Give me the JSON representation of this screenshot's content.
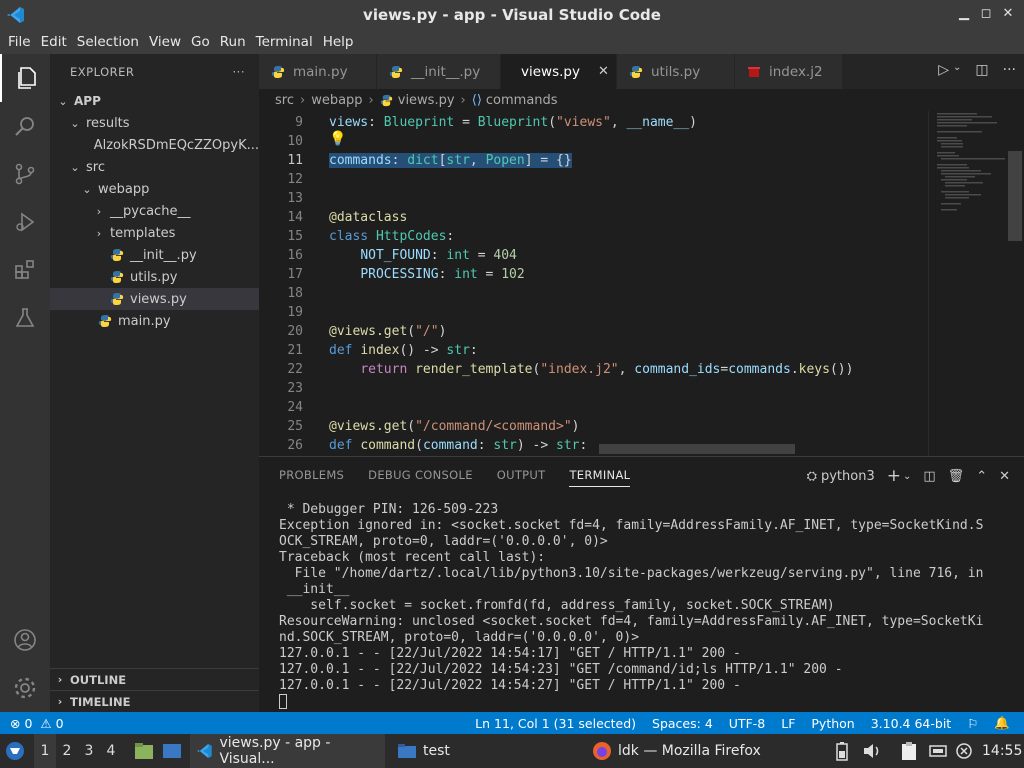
{
  "window": {
    "title": "views.py - app - Visual Studio Code"
  },
  "menu": [
    "File",
    "Edit",
    "Selection",
    "View",
    "Go",
    "Run",
    "Terminal",
    "Help"
  ],
  "sidebar": {
    "header": "EXPLORER",
    "more": "···",
    "tree": [
      {
        "label": "APP",
        "depth": 0,
        "chev": "⌄",
        "kind": "root"
      },
      {
        "label": "results",
        "depth": 1,
        "chev": "⌄",
        "kind": "folder"
      },
      {
        "label": "AlzokRSDmEQcZZOpyK...",
        "depth": 2,
        "chev": "",
        "kind": "file"
      },
      {
        "label": "src",
        "depth": 1,
        "chev": "⌄",
        "kind": "folder"
      },
      {
        "label": "webapp",
        "depth": 2,
        "chev": "⌄",
        "kind": "folder"
      },
      {
        "label": "__pycache__",
        "depth": 3,
        "chev": "›",
        "kind": "folder"
      },
      {
        "label": "templates",
        "depth": 3,
        "chev": "›",
        "kind": "folder"
      },
      {
        "label": "__init__.py",
        "depth": 3,
        "chev": "",
        "kind": "py"
      },
      {
        "label": "utils.py",
        "depth": 3,
        "chev": "",
        "kind": "py"
      },
      {
        "label": "views.py",
        "depth": 3,
        "chev": "",
        "kind": "py",
        "selected": true
      },
      {
        "label": "main.py",
        "depth": 2,
        "chev": "",
        "kind": "py"
      }
    ],
    "outline": "OUTLINE",
    "timeline": "TIMELINE"
  },
  "tabs": [
    {
      "label": "main.py",
      "icon": "python-icon",
      "active": false
    },
    {
      "label": "__init__.py",
      "icon": "python-icon",
      "active": false
    },
    {
      "label": "views.py",
      "icon": "python-icon",
      "active": true
    },
    {
      "label": "utils.py",
      "icon": "python-icon",
      "active": false
    },
    {
      "label": "index.j2",
      "icon": "jinja-icon",
      "active": false
    }
  ],
  "breadcrumb": [
    "src",
    "webapp",
    "views.py",
    "commands"
  ],
  "editor": {
    "lines": [
      {
        "n": "9",
        "html": "<span class='var'>views</span>: <span class='cls'>Blueprint</span> = <span class='cls'>Blueprint</span>(<span class='str'>\"views\"</span>, <span class='var'>__name__</span>)"
      },
      {
        "n": "10",
        "html": ""
      },
      {
        "n": "11",
        "html": "<span class='sel'><span class='var'>commands</span>: <span class='cls'>dict</span>[<span class='cls'>str</span>, <span class='cls'>Popen</span>] = {}</span>",
        "current": true
      },
      {
        "n": "12",
        "html": ""
      },
      {
        "n": "13",
        "html": ""
      },
      {
        "n": "14",
        "html": "<span class='dec'>@dataclass</span>"
      },
      {
        "n": "15",
        "html": "<span class='kw'>class</span> <span class='cls'>HttpCodes</span>:"
      },
      {
        "n": "16",
        "html": "    <span class='var'>NOT_FOUND</span>: <span class='cls'>int</span> = <span class='num'>404</span>"
      },
      {
        "n": "17",
        "html": "    <span class='var'>PROCESSING</span>: <span class='cls'>int</span> = <span class='num'>102</span>"
      },
      {
        "n": "18",
        "html": ""
      },
      {
        "n": "19",
        "html": ""
      },
      {
        "n": "20",
        "html": "<span class='dec'>@views.get</span>(<span class='str'>\"/\"</span>)"
      },
      {
        "n": "21",
        "html": "<span class='kw'>def</span> <span class='fn'>index</span>() -> <span class='cls'>str</span>:"
      },
      {
        "n": "22",
        "html": "    <span style='color:#c586c0'>return</span> <span class='fn'>render_template</span>(<span class='str'>\"index.j2\"</span>, <span class='var'>command_ids</span>=<span class='var'>commands</span>.<span class='fn'>keys</span>())"
      },
      {
        "n": "23",
        "html": ""
      },
      {
        "n": "24",
        "html": ""
      },
      {
        "n": "25",
        "html": "<span class='dec'>@views.get</span>(<span class='str'>\"/command/&lt;command&gt;\"</span>)"
      },
      {
        "n": "26",
        "html": "<span class='kw'>def</span> <span class='fn'>command</span>(<span class='var'>command</span>: <span class='cls'>str</span>) -> <span class='cls'>str</span>:"
      }
    ]
  },
  "panel": {
    "tabs": [
      "PROBLEMS",
      "DEBUG CONSOLE",
      "OUTPUT",
      "TERMINAL"
    ],
    "active_tab": "TERMINAL",
    "terminal_name": "python3",
    "terminal_lines": [
      " * Debugger PIN: 126-509-223",
      "Exception ignored in: <socket.socket fd=4, family=AddressFamily.AF_INET, type=SocketKind.S",
      "OCK_STREAM, proto=0, laddr=('0.0.0.0', 0)>",
      "Traceback (most recent call last):",
      "  File \"/home/dartz/.local/lib/python3.10/site-packages/werkzeug/serving.py\", line 716, in",
      " __init__",
      "    self.socket = socket.fromfd(fd, address_family, socket.SOCK_STREAM)",
      "ResourceWarning: unclosed <socket.socket fd=4, family=AddressFamily.AF_INET, type=SocketKi",
      "nd.SOCK_STREAM, proto=0, laddr=('0.0.0.0', 0)>",
      "127.0.0.1 - - [22/Jul/2022 14:54:17] \"GET / HTTP/1.1\" 200 -",
      "127.0.0.1 - - [22/Jul/2022 14:54:23] \"GET /command/id;ls HTTP/1.1\" 200 -",
      "127.0.0.1 - - [22/Jul/2022 14:54:27] \"GET / HTTP/1.1\" 200 -"
    ]
  },
  "status": {
    "errors": "0",
    "warnings": "0",
    "position": "Ln 11, Col 1 (31 selected)",
    "spaces": "Spaces: 4",
    "encoding": "UTF-8",
    "eol": "LF",
    "language": "Python",
    "interpreter": "3.10.4 64-bit"
  },
  "taskbar": {
    "workspaces": [
      "1",
      "2",
      "3",
      "4"
    ],
    "vscode_label": "views.py - app - Visual...",
    "folder_label": "test",
    "firefox_label": "ldk — Mozilla Firefox",
    "clock": "14:55"
  },
  "colors": {
    "statusbar": "#007acc",
    "accent": "#007acc",
    "selection": "#264f78"
  }
}
